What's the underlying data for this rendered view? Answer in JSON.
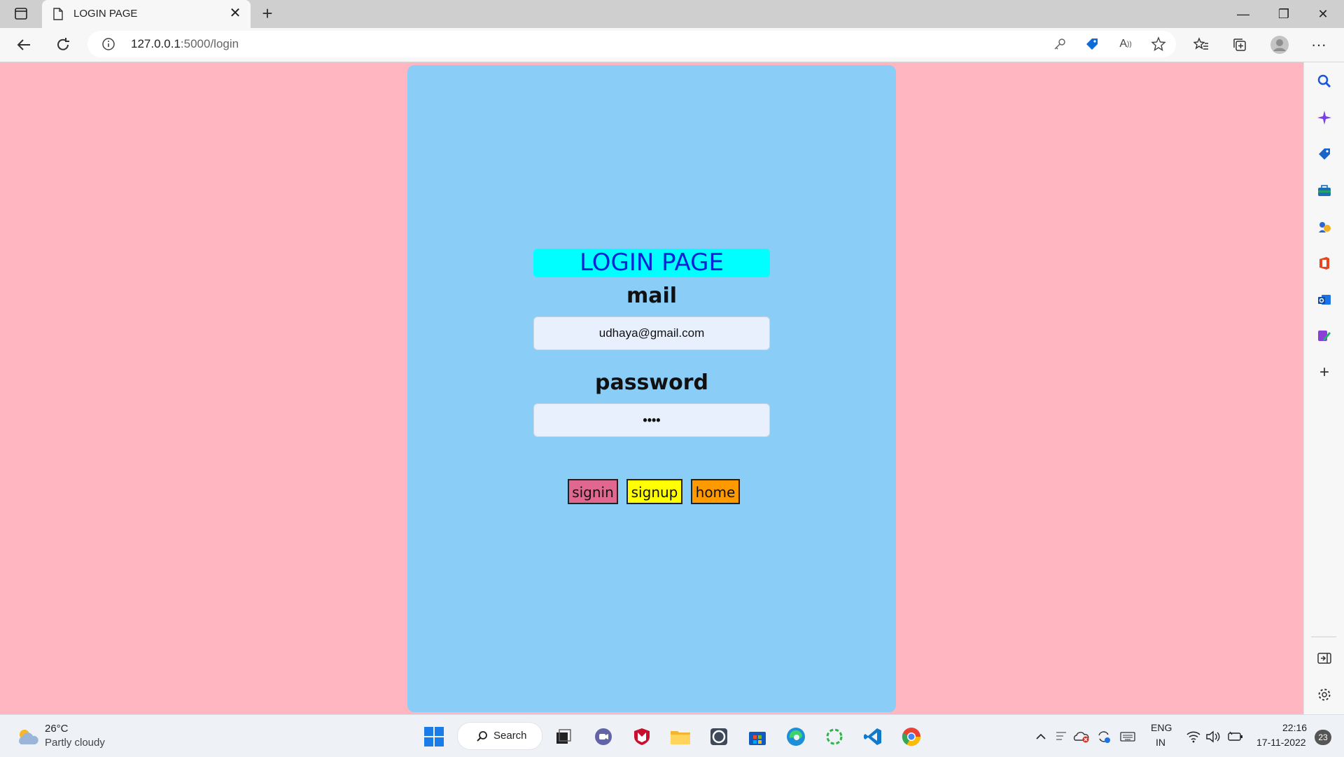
{
  "browser": {
    "tab_title": "LOGIN PAGE",
    "url_host": "127.0.0.1",
    "url_path": ":5000/login"
  },
  "page": {
    "heading": "LOGIN PAGE",
    "mail_label": "mail",
    "mail_value": "udhaya@gmail.com",
    "password_label": "password",
    "password_value": "••••",
    "buttons": {
      "signin": "signin",
      "signup": "signup",
      "home": "home"
    },
    "colors": {
      "background": "#ffb6c1",
      "card": "#8acef7",
      "heading_bg": "#00ffff",
      "heading_text": "#0a23d8",
      "signin_bg": "#e0678f",
      "signup_bg": "#ffff00",
      "home_bg": "#ff9900"
    }
  },
  "taskbar": {
    "weather_temp": "26°C",
    "weather_desc": "Partly cloudy",
    "search_label": "Search",
    "lang_top": "ENG",
    "lang_bottom": "IN",
    "time": "22:16",
    "date": "17-11-2022",
    "notification_count": "23"
  }
}
